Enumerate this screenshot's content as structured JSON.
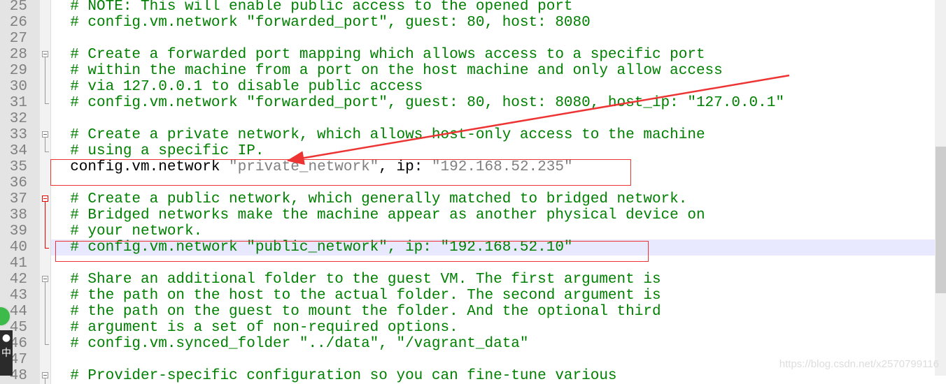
{
  "lines": [
    {
      "n": "25",
      "parts": [
        [
          "c",
          "  # NOTE: This will enable public access to the opened port"
        ]
      ]
    },
    {
      "n": "26",
      "parts": [
        [
          "c",
          "  # config.vm.network \"forwarded_port\", guest: 80, host: 8080"
        ]
      ]
    },
    {
      "n": "27",
      "parts": []
    },
    {
      "n": "28",
      "fold": "start",
      "parts": [
        [
          "c",
          "  # Create a forwarded port mapping which allows access to a specific port"
        ]
      ]
    },
    {
      "n": "29",
      "fold": "mid",
      "parts": [
        [
          "c",
          "  # within the machine from a port on the host machine and only allow access"
        ]
      ]
    },
    {
      "n": "30",
      "fold": "mid",
      "parts": [
        [
          "c",
          "  # via 127.0.0.1 to disable public access"
        ]
      ]
    },
    {
      "n": "31",
      "fold": "end",
      "parts": [
        [
          "c",
          "  # config.vm.network \"forwarded_port\", guest: 80, host: 8080, host_ip: \"127.0.0.1\""
        ]
      ]
    },
    {
      "n": "32",
      "parts": []
    },
    {
      "n": "33",
      "fold": "start",
      "parts": [
        [
          "c",
          "  # Create a private network, which allows host-only access to the machine"
        ]
      ]
    },
    {
      "n": "34",
      "fold": "end",
      "parts": [
        [
          "c",
          "  # using a specific IP."
        ]
      ]
    },
    {
      "n": "35",
      "parts": [
        [
          "k",
          "  config.vm.network "
        ],
        [
          "s",
          "\"private_network\""
        ],
        [
          "k",
          ", ip: "
        ],
        [
          "s",
          "\"192.168.52.235\""
        ]
      ]
    },
    {
      "n": "36",
      "parts": []
    },
    {
      "n": "37",
      "fold": "start-red",
      "parts": [
        [
          "c",
          "  # Create a public network, which generally matched to bridged network."
        ]
      ]
    },
    {
      "n": "38",
      "fold": "mid-red",
      "parts": [
        [
          "c",
          "  # Bridged networks make the machine appear as another physical device on"
        ]
      ]
    },
    {
      "n": "39",
      "fold": "mid-red",
      "parts": [
        [
          "c",
          "  # your network."
        ]
      ]
    },
    {
      "n": "40",
      "fold": "end-red",
      "current": true,
      "parts": [
        [
          "c",
          "  # config.vm.network \"public_network\", ip: \"192.168.52.10\""
        ]
      ]
    },
    {
      "n": "41",
      "parts": []
    },
    {
      "n": "42",
      "fold": "start",
      "parts": [
        [
          "c",
          "  # Share an additional folder to the guest VM. The first argument is"
        ]
      ]
    },
    {
      "n": "43",
      "fold": "mid",
      "parts": [
        [
          "c",
          "  # the path on the host to the actual folder. The second argument is"
        ]
      ]
    },
    {
      "n": "44",
      "fold": "mid",
      "parts": [
        [
          "c",
          "  # the path on the guest to mount the folder. And the optional third"
        ]
      ]
    },
    {
      "n": "45",
      "fold": "mid",
      "parts": [
        [
          "c",
          "  # argument is a set of non-required options."
        ]
      ]
    },
    {
      "n": "46",
      "fold": "end",
      "parts": [
        [
          "c",
          "  # config.vm.synced_folder \"../data\", \"/vagrant_data\""
        ]
      ]
    },
    {
      "n": "47",
      "parts": []
    },
    {
      "n": "48",
      "fold": "start",
      "parts": [
        [
          "c",
          "  # Provider-specific configuration so you can fine-tune various"
        ]
      ]
    }
  ],
  "watermark": "https://blog.csdn.net/x2570799116",
  "tray": {
    "label": "中"
  },
  "colors": {
    "comment": "#008000",
    "string": "#808080",
    "annotation": "#e33333",
    "current_line": "#e8e8ff"
  }
}
